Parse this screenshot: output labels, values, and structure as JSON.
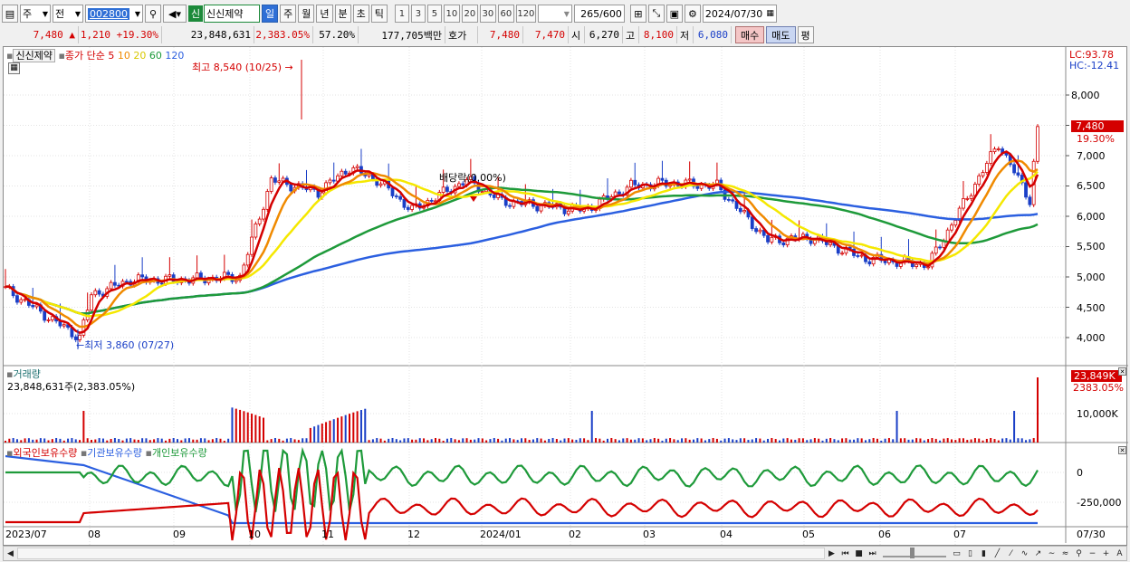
{
  "toolbar": {
    "type": "주",
    "front": "전",
    "code": "002800",
    "market_badge": "신",
    "name": "신신제약",
    "periods": [
      "일",
      "주",
      "월",
      "년",
      "분",
      "초",
      "틱"
    ],
    "active_period": "일",
    "intervals": [
      "1",
      "3",
      "5",
      "10",
      "20",
      "30",
      "60",
      "120"
    ],
    "count": "265",
    "count_max": "/600",
    "date": "2024/07/30"
  },
  "quote": {
    "price": "7,480",
    "arrow": "▲",
    "change": "1,210",
    "change_pct": "+19.30%",
    "volume": "23,848,631",
    "vol_ratio": "2,383.05%",
    "turnover": "57.20%",
    "amount": "177,705백만",
    "hoga_label": "호가",
    "ask": "7,480",
    "bid": "7,470",
    "open_label": "시",
    "open": "6,270",
    "high_label": "고",
    "high": "8,100",
    "low_label": "저",
    "low": "6,080",
    "buy": "매수",
    "sell": "매도",
    "eval": "평"
  },
  "price_panel": {
    "legend_name": "신신제약",
    "legend_close": "종가",
    "legend_sma": "단순",
    "ma_labels": [
      "5",
      "10",
      "20",
      "60",
      "120"
    ],
    "ma_colors": [
      "#d40000",
      "#f08a00",
      "#f5e800",
      "#1e9a3a",
      "#2b5fe0"
    ],
    "lc": "LC:93.78",
    "hc": "HC:-12.41",
    "high_note": "최고 8,540 (10/25)",
    "low_note": "최저 3,860 (07/27)",
    "dividend_note": "배당락(0.00%)",
    "last_price": "7,480",
    "last_pct": "19.30%",
    "y_ticks": [
      "8,000",
      "7,500",
      "7,000",
      "6,500",
      "6,000",
      "5,500",
      "5,000",
      "4,500",
      "4,000"
    ]
  },
  "volume_panel": {
    "title": "거래량",
    "detail": "23,848,631주(2,383.05%)",
    "last": "23,849K",
    "last_pct": "2383.05%",
    "tick": "10,000K"
  },
  "holder_panel": {
    "labels": [
      "외국인보유수량",
      "기관보유수량",
      "개인보유수량"
    ],
    "colors": [
      "#d40000",
      "#2b5fe0",
      "#1e9a3a"
    ],
    "ticks": [
      "0",
      "-250,000"
    ]
  },
  "x_axis": [
    "2023/07",
    "08",
    "09",
    "10",
    "11",
    "12",
    "2024/01",
    "02",
    "03",
    "04",
    "05",
    "06",
    "07"
  ],
  "x_last": "07/30",
  "chart_data": {
    "type": "candlestick",
    "ylim": [
      3700,
      8400
    ],
    "months": [
      "2023/07",
      "08",
      "09",
      "10",
      "11",
      "12",
      "2024/01",
      "02",
      "03",
      "04",
      "05",
      "06",
      "07"
    ],
    "close_trend": [
      [
        "2023/07",
        4800
      ],
      [
        "2023/07-27",
        4000
      ],
      [
        "08",
        4700
      ],
      [
        "08-mid",
        4950
      ],
      [
        "09",
        4950
      ],
      [
        "09-end",
        5000
      ],
      [
        "10",
        6600
      ],
      [
        "10-25",
        6400
      ],
      [
        "11",
        6800
      ],
      [
        "11-mid",
        6600
      ],
      [
        "12",
        6100
      ],
      [
        "12-mid",
        6600
      ],
      [
        "2024/01",
        6250
      ],
      [
        "02",
        6100
      ],
      [
        "03",
        6500
      ],
      [
        "03-mid",
        6550
      ],
      [
        "04",
        6500
      ],
      [
        "04-mid",
        5600
      ],
      [
        "05",
        5650
      ],
      [
        "06",
        5300
      ],
      [
        "07",
        5200
      ],
      [
        "07-20",
        7200
      ],
      [
        "07-29",
        6270
      ],
      [
        "07/30",
        7480
      ]
    ]
  }
}
